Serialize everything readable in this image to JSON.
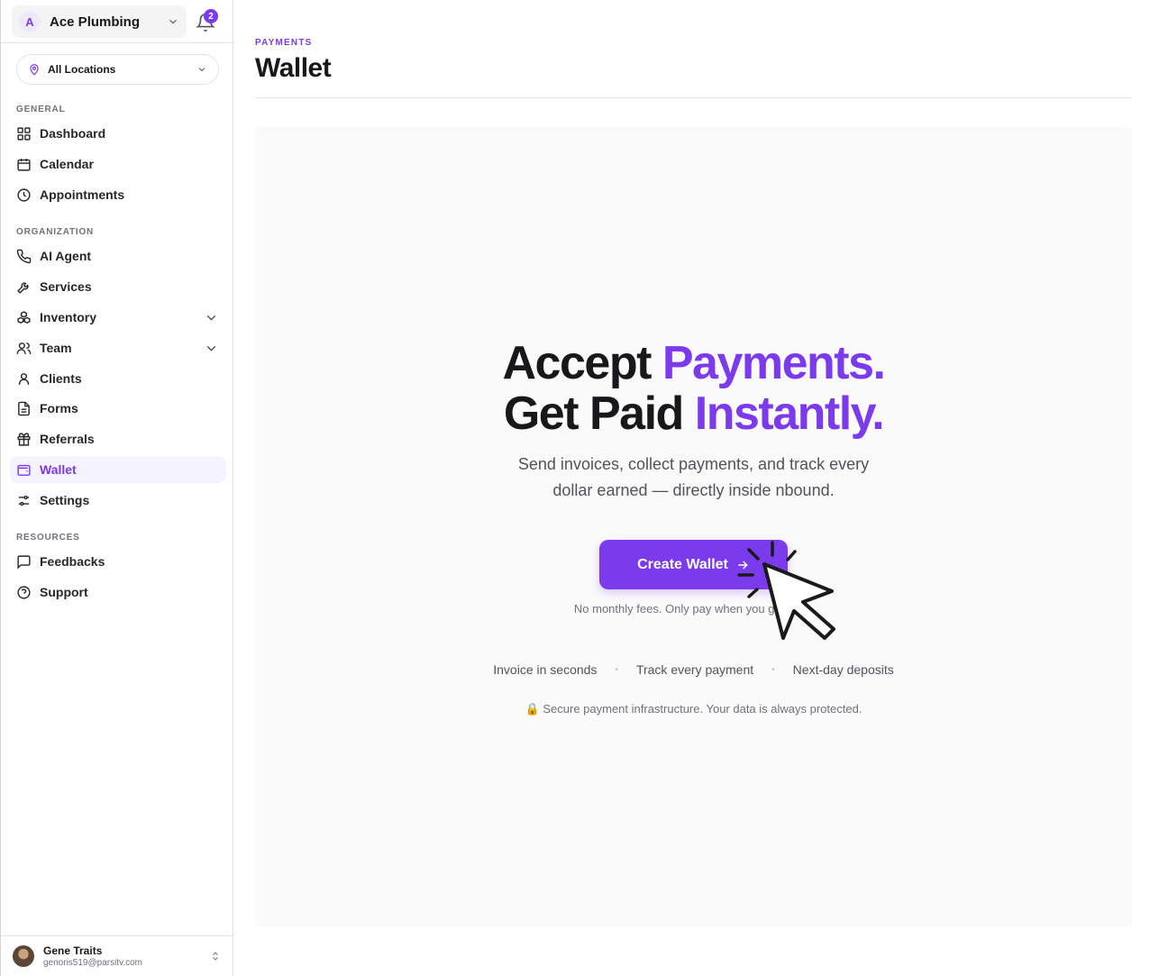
{
  "org": {
    "initial": "A",
    "name": "Ace Plumbing"
  },
  "notifications": {
    "count": "2"
  },
  "location_filter": {
    "label": "All Locations"
  },
  "sidebar": {
    "sections": {
      "general": "GENERAL",
      "organization": "ORGANIZATION",
      "resources": "RESOURCES"
    },
    "items": [
      {
        "label": "Dashboard",
        "icon": "dashboard-icon"
      },
      {
        "label": "Calendar",
        "icon": "calendar-icon"
      },
      {
        "label": "Appointments",
        "icon": "clock-icon"
      },
      {
        "label": "AI Agent",
        "icon": "phone-icon"
      },
      {
        "label": "Services",
        "icon": "wrench-icon"
      },
      {
        "label": "Inventory",
        "icon": "boxes-icon",
        "expandable": true
      },
      {
        "label": "Team",
        "icon": "team-icon",
        "expandable": true
      },
      {
        "label": "Clients",
        "icon": "user-icon"
      },
      {
        "label": "Forms",
        "icon": "document-icon"
      },
      {
        "label": "Referrals",
        "icon": "gift-icon"
      },
      {
        "label": "Wallet",
        "icon": "wallet-icon",
        "active": true
      },
      {
        "label": "Settings",
        "icon": "sliders-icon"
      },
      {
        "label": "Feedbacks",
        "icon": "message-icon"
      },
      {
        "label": "Support",
        "icon": "help-icon"
      }
    ]
  },
  "user": {
    "name": "Gene Traits",
    "email": "genoris519@parsitv.com"
  },
  "page": {
    "breadcrumb": "PAYMENTS",
    "title": "Wallet"
  },
  "hero": {
    "line1_plain": "Accept ",
    "line1_accent": "Payments.",
    "line2_plain": "Get Paid ",
    "line2_accent": "Instantly.",
    "subtitle_line1": "Send invoices, collect payments, and track every",
    "subtitle_line2": "dollar earned — directly inside nbound.",
    "cta_label": "Create Wallet",
    "note": "No monthly fees. Only pay when you get paid.",
    "features": [
      "Invoice in seconds",
      "Track every payment",
      "Next-day deposits"
    ],
    "secure_icon": "🔒",
    "secure_text": "Secure payment infrastructure. Your data is always protected."
  },
  "colors": {
    "accent": "#7c3aed",
    "panel": "#fafafa",
    "active_bg": "#f5f3ff"
  }
}
